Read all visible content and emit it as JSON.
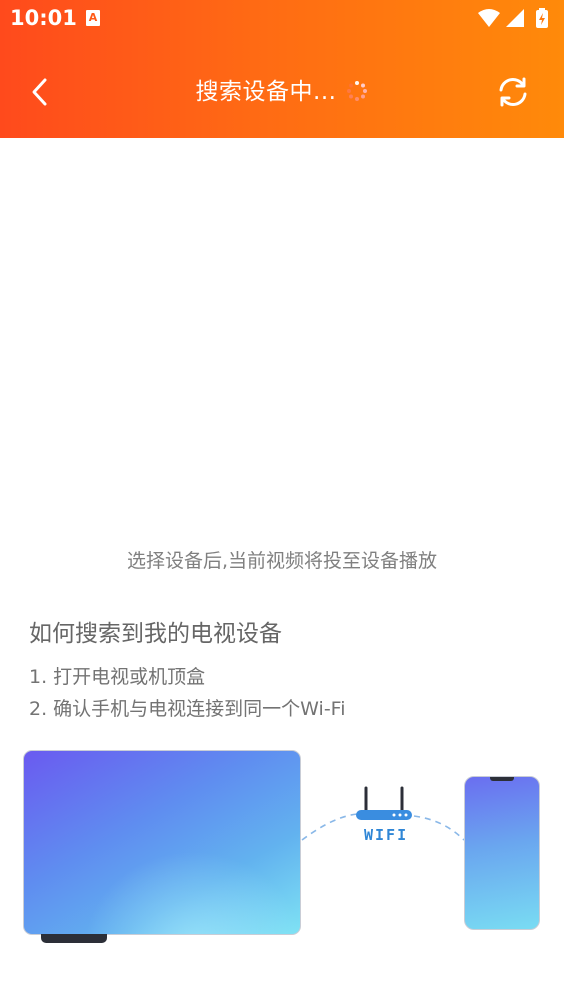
{
  "status_bar": {
    "time": "10:01",
    "notification_icon": "A"
  },
  "header": {
    "title": "搜索设备中...",
    "back_icon": "chevron-left-icon",
    "refresh_icon": "refresh-icon"
  },
  "hint": "选择设备后,当前视频将投至设备播放",
  "howto": {
    "title": "如何搜索到我的电视设备",
    "steps": [
      "1. 打开电视或机顶盒",
      "2. 确认手机与电视连接到同一个Wi-Fi"
    ]
  },
  "illustration": {
    "wifi_label": "WIFI"
  },
  "colors": {
    "header_start": "#ff4a1c",
    "header_end": "#ff8a0a",
    "wifi_blue": "#2f86d6"
  }
}
